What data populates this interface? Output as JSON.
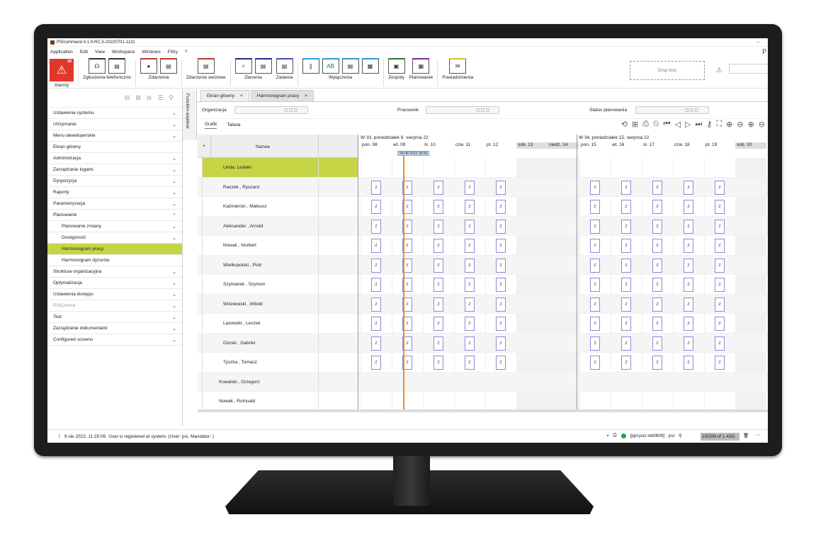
{
  "window": {
    "title": "PSIcommand 4.1.0-RC-5-20220701-1131",
    "min": "–"
  },
  "menu": {
    "items": [
      "Application",
      "Edit",
      "View",
      "Workspace",
      "Windows",
      "Filtry",
      "?"
    ],
    "brand": "P"
  },
  "toolbar": {
    "alarm_badge": "18",
    "alarm_label": "Alarmy",
    "phone_label": "Zgłoszenia telefoniczne",
    "events_label": "Zdarzenia",
    "net_events_label": "Zdarzenia sieciowe",
    "orders_label": "Zlecenia",
    "tasks_label": "Zadania",
    "outages_label": "Wyłączenia",
    "teams_label": "Zespoły",
    "planning_label": "Planowanie",
    "notifications_label": "Powiadomienia",
    "dropbox": "Drop box",
    "colors": {
      "phone": "#333333",
      "events": "#c0392b",
      "orders": "#1e2a8a",
      "tasks": "#3a4fbf",
      "outages": "#2c9fd6",
      "teams": "#1f7a2e",
      "planning": "#7a2a9a",
      "notify": "#d4c02a"
    }
  },
  "sidebar": {
    "items": [
      {
        "label": "Ustawienia systemu",
        "chev": "⌄"
      },
      {
        "label": "Utrzymanie",
        "chev": "⌄"
      },
      {
        "label": "Menu deweloperskie",
        "chev": "⌄"
      },
      {
        "label": "Ekran główny",
        "chev": ""
      },
      {
        "label": "Administracja",
        "chev": "⌄"
      },
      {
        "label": "Zarządzanie logami",
        "chev": "⌄"
      },
      {
        "label": "Dyspozycja",
        "chev": "⌄"
      },
      {
        "label": "Raporty",
        "chev": "⌄"
      },
      {
        "label": "Parametryzacja",
        "chev": "⌄"
      },
      {
        "label": "Planowanie",
        "chev": "⌃"
      },
      {
        "label": "Planowanie zmiany",
        "chev": "⌄",
        "sub": true
      },
      {
        "label": "Dostępność",
        "chev": "⌄",
        "sub": true
      },
      {
        "label": "Harmonogram pracy",
        "chev": "",
        "sub": true,
        "selected": true
      },
      {
        "label": "Harmonogram dyżurów",
        "chev": "",
        "sub": true
      },
      {
        "label": "Struktura organizacyjna",
        "chev": "⌄"
      },
      {
        "label": "Optymalizacja",
        "chev": "⌄"
      },
      {
        "label": "Ustawienia dostępu",
        "chev": "⌄"
      },
      {
        "label": "PSIControl",
        "chev": "⌄",
        "disabled": true
      },
      {
        "label": "Test",
        "chev": "⌄"
      },
      {
        "label": "Zarządzanie dokumentami",
        "chev": "⌄"
      },
      {
        "label": "Configured screens",
        "chev": "⌄"
      }
    ]
  },
  "function_explorer": "Function explorer",
  "tabs": [
    {
      "label": "Ekran główny",
      "close": "×"
    },
    {
      "label": "Harmonogram pracy",
      "close": "×"
    }
  ],
  "filters": {
    "org": "Organizacja",
    "worker": "Pracownik",
    "status": "Status planowania",
    "btns": "▢▢▢"
  },
  "view_tabs": [
    "Grafik",
    "Tabela"
  ],
  "grid": {
    "pin": "•",
    "column_name": "Nazwa",
    "weeks": [
      "W 33, poniedziałek 8. sierpnia 22",
      "W 34, poniedziałek 15. sierpnia 22"
    ],
    "days": [
      "pon. 08",
      "wt. 09",
      "śr. 10",
      "czw. 11",
      "pt. 12",
      "sob. 13",
      "niedz. 14",
      "pon. 15",
      "wt. 16",
      "śr. 17",
      "czw. 18",
      "pt. 19",
      "sob. 20"
    ],
    "now_label": "09-08-2022 06:56",
    "shift_label": "Z",
    "rows": [
      "Linda, Lesław",
      "Raczek , Ryszard",
      "Kaźmierski , Mateusz",
      "Aleksander , Arnold",
      "Nowak , Norbert",
      "Wielkopolski , Piotr",
      "Szymanek , Szymon",
      "Wiśniewski , Witold",
      "Lasowski , Leszek",
      "Górski , Gabriel",
      "Tyszka , Tomasz",
      "Kowalski , Grzegorz",
      "Nowak , Romuald"
    ]
  },
  "status": {
    "time": "9 sie 2022, 11:25:06",
    "message": "User is registered at system. (User: psi, Mandator: )",
    "host": "[ppl-poz-nb0609] : psi",
    "memory": "1002M of 1.43G"
  }
}
